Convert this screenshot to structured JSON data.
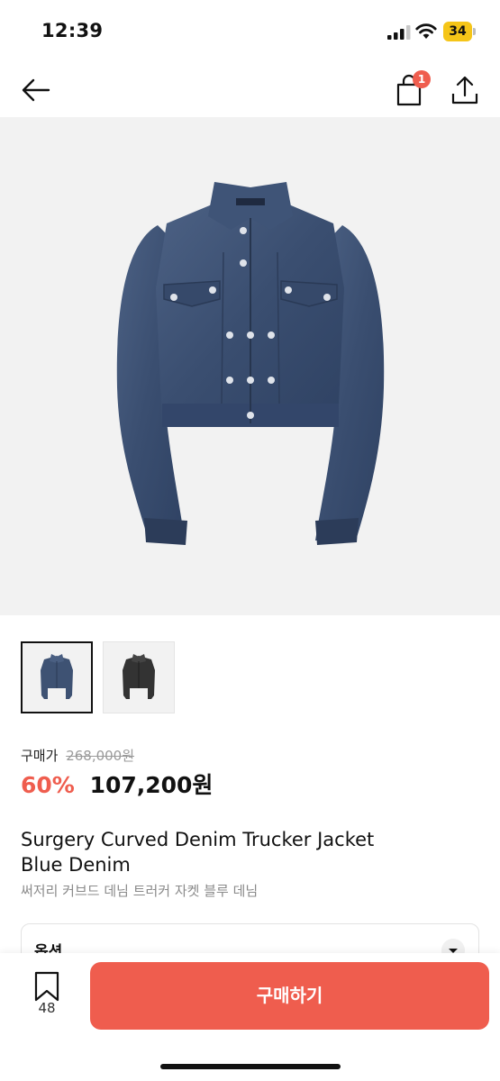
{
  "status_bar": {
    "time": "12:39",
    "battery": "34",
    "icons": [
      "cellular-signal-icon",
      "wifi-icon",
      "battery-icon"
    ]
  },
  "nav": {
    "back_icon": "arrow-left-icon",
    "bag_icon": "shopping-bag-icon",
    "bag_badge": "1",
    "share_icon": "share-icon"
  },
  "product": {
    "thumbnails": [
      "blue-denim-thumbnail",
      "black-denim-thumbnail"
    ],
    "price_label": "구매가",
    "original_price": "268,000원",
    "discount": "60%",
    "sale_price": "107,200원",
    "title_line1": "Surgery Curved Denim Trucker Jacket",
    "title_line2": "Blue Denim",
    "title_ko": "써저리 커브드 데님 트러커 자켓 블루 데님"
  },
  "options": {
    "label": "옵션"
  },
  "bottom": {
    "bookmark_icon": "bookmark-icon",
    "bookmark_count": "48",
    "buy_label": "구매하기"
  },
  "colors": {
    "accent": "#ef5d4e",
    "battery": "#f5c518",
    "hero_bg": "#f2f2f2",
    "denim": "#3e5273"
  }
}
